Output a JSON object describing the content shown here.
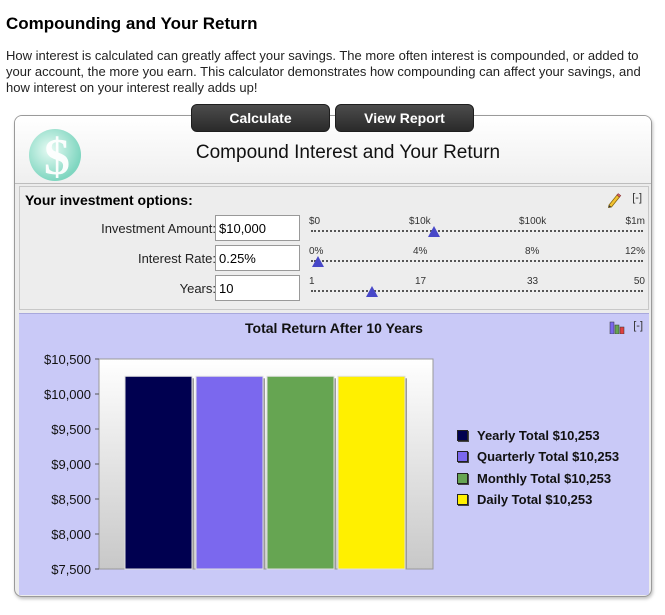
{
  "page": {
    "title": "Compounding and Your Return",
    "intro": "How interest is calculated can greatly affect your savings. The more often interest is compounded, or added to your account, the more you earn. This calculator demonstrates how compounding can affect your savings, and how interest on your interest really adds up!"
  },
  "buttons": {
    "calculate": "Calculate",
    "view_report": "View Report"
  },
  "calculator": {
    "title": "Compound Interest and Your Return",
    "options_title": "Your investment options:",
    "collapse_label": "[-]",
    "fields": [
      {
        "label": "Investment Amount:",
        "value": "$10,000",
        "ticks": [
          "$0",
          "$10k",
          "$100k",
          "$1m"
        ],
        "slider_position": 0.37
      },
      {
        "label": "Interest Rate:",
        "value": "0.25%",
        "ticks": [
          "0%",
          "4%",
          "8%",
          "12%"
        ],
        "slider_position": 0.021
      },
      {
        "label": "Years:",
        "value": "10",
        "ticks": [
          "1",
          "17",
          "33",
          "50"
        ],
        "slider_position": 0.184
      }
    ]
  },
  "results": {
    "title": "Total Return After 10 Years",
    "collapse_label": "[-]",
    "legend": [
      {
        "label": "Yearly Total $10,253",
        "color": "#000050"
      },
      {
        "label": "Quarterly Total $10,253",
        "color": "#7b68ee"
      },
      {
        "label": "Monthly Total $10,253",
        "color": "#66a552"
      },
      {
        "label": "Daily Total $10,253",
        "color": "#fff000"
      }
    ]
  },
  "chart_data": {
    "type": "bar",
    "categories": [
      "Yearly",
      "Quarterly",
      "Monthly",
      "Daily"
    ],
    "values": [
      10253,
      10253,
      10253,
      10253
    ],
    "colors": [
      "#000050",
      "#7b68ee",
      "#66a552",
      "#fff000"
    ],
    "title": "Total Return After 10 Years",
    "xlabel": "",
    "ylabel": "",
    "ylim": [
      7500,
      10500
    ],
    "yticks": [
      "$10,500",
      "$10,000",
      "$9,500",
      "$9,000",
      "$8,500",
      "$8,000",
      "$7,500"
    ],
    "ytick_values": [
      10500,
      10000,
      9500,
      9000,
      8500,
      8000,
      7500
    ],
    "grid": true,
    "legend_position": "right"
  }
}
